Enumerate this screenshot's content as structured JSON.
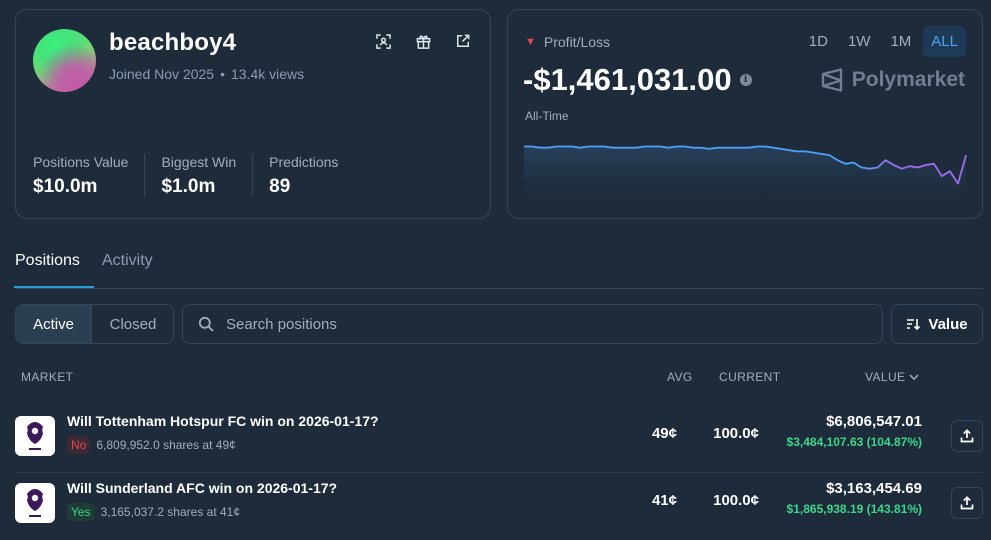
{
  "profile": {
    "username": "beachboy4",
    "joined": "Joined Nov 2025",
    "views": "13.4k views",
    "separator": "•",
    "icons": [
      "scan-icon",
      "gift-icon",
      "external-link-icon"
    ],
    "stats": [
      {
        "label": "Positions Value",
        "value": "$10.0m"
      },
      {
        "label": "Biggest Win",
        "value": "$1.0m"
      },
      {
        "label": "Predictions",
        "value": "89"
      }
    ]
  },
  "pnl": {
    "label": "Profit/Loss",
    "value": "-$1,461,031.00",
    "subtitle": "All-Time",
    "ranges": [
      "1D",
      "1W",
      "1M",
      "ALL"
    ],
    "active_range": "ALL",
    "brand": "Polymarket",
    "info_glyph": "i",
    "colors": {
      "line_start": "#4ea1f7",
      "line_end": "#a06cf0",
      "negative": "#e5484d"
    },
    "chart_data": {
      "type": "line",
      "series": [
        {
          "values": [
            0,
            0,
            -1,
            -1,
            0,
            0,
            0,
            -1,
            0,
            0,
            0,
            -1,
            -1,
            -1,
            -1,
            0,
            0,
            0,
            -1,
            0,
            0,
            -1,
            -1,
            -2,
            -1,
            -1,
            -1,
            -1,
            -1,
            0,
            0,
            -1,
            -2,
            -3,
            -4,
            -4,
            -5,
            -6,
            -7,
            -11,
            -14,
            -13,
            -17,
            -18,
            -17,
            -11,
            -15,
            -18,
            -16,
            -17,
            -15,
            -14,
            -24,
            -20,
            -30,
            -7
          ]
        }
      ]
    }
  },
  "tabs": {
    "positions": "Positions",
    "activity": "Activity"
  },
  "filters": {
    "active": "Active",
    "closed": "Closed",
    "search_placeholder": "Search positions",
    "sort_label": "Value"
  },
  "table": {
    "headers": {
      "market": "MARKET",
      "avg": "AVG",
      "current": "CURRENT",
      "value": "VALUE"
    },
    "rows": [
      {
        "title": "Will Tottenham Hotspur FC win on 2026-01-17?",
        "outcome": "No",
        "shares": "6,809,952.0 shares at 49¢",
        "avg": "49¢",
        "current": "100.0¢",
        "value": "$6,806,547.01",
        "pnl": "$3,484,107.63 (104.87%)"
      },
      {
        "title": "Will Sunderland AFC win on 2026-01-17?",
        "outcome": "Yes",
        "shares": "3,165,037.2 shares at 41¢",
        "avg": "41¢",
        "current": "100.0¢",
        "value": "$3,163,454.69",
        "pnl": "$1,865,938.19 (143.81%)"
      }
    ]
  }
}
